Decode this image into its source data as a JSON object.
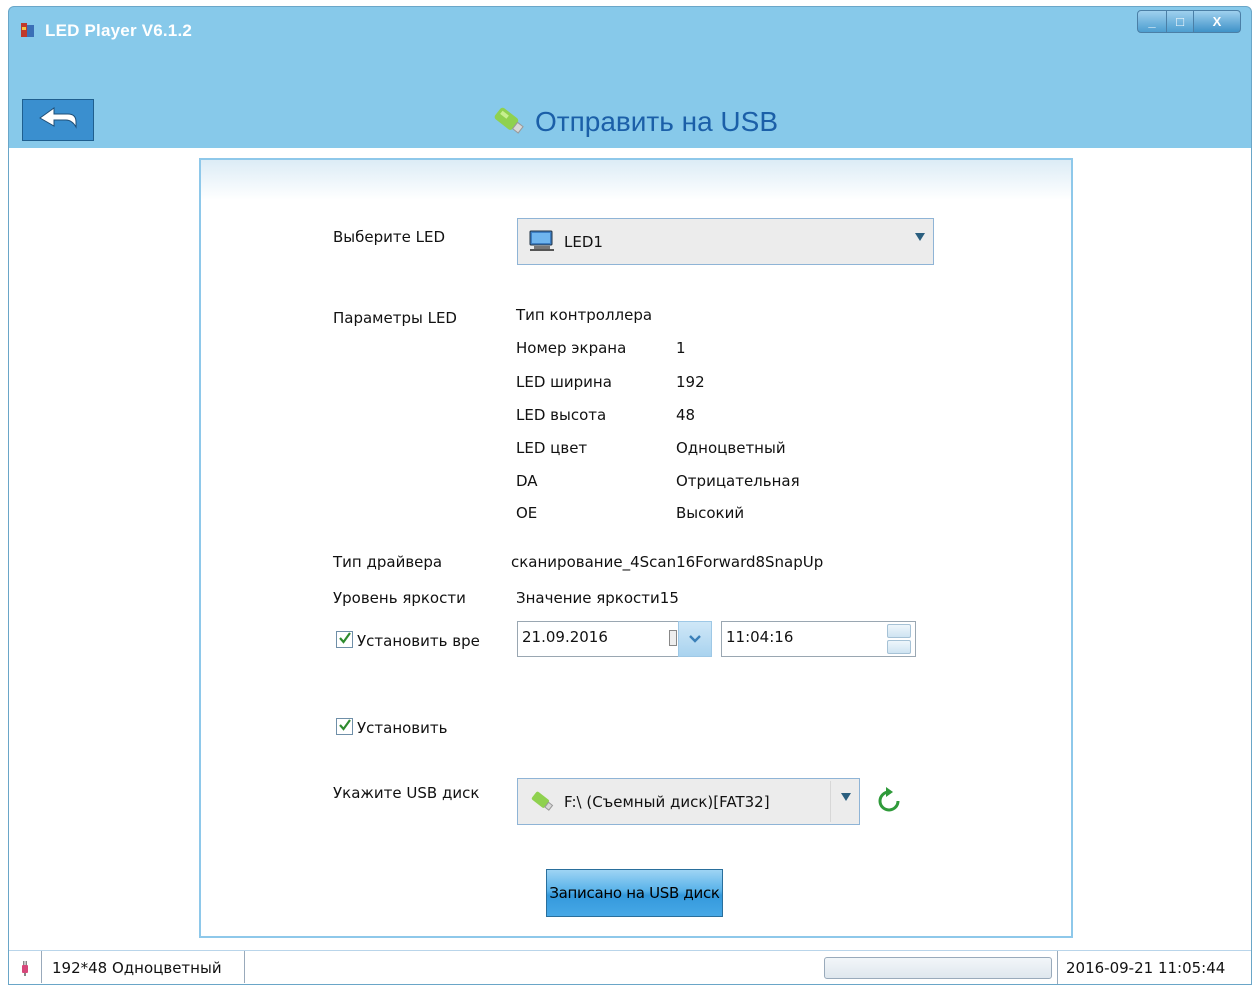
{
  "window": {
    "title": "LED Player V6.1.2",
    "controls": {
      "minimize": "_",
      "maximize": "□",
      "close": "X"
    }
  },
  "header": {
    "title": "Отправить на USB"
  },
  "form": {
    "select_led_label": "Выберите LED",
    "led_selected": "LED1",
    "led_params_label": "Параметры LED",
    "params": [
      {
        "name": "Тип контроллера",
        "value": ""
      },
      {
        "name": "Номер экрана",
        "value": "1"
      },
      {
        "name": "LED ширина",
        "value": "192"
      },
      {
        "name": "LED высота",
        "value": "48"
      },
      {
        "name": "LED цвет",
        "value": "Одноцветный"
      },
      {
        "name": "DA",
        "value": "Отрицательная"
      },
      {
        "name": "OE",
        "value": "Высокий"
      }
    ],
    "driver_type_label": "Тип драйвера",
    "driver_type_value": "сканирование_4Scan16Forward8SnapUp",
    "brightness_label": "Уровень яркости",
    "brightness_value": "Значение яркости15",
    "set_time_label": "Установить вре",
    "set_time_checked": true,
    "date_value": "21.09.2016",
    "time_value": "11:04:16",
    "set_label": "Установить",
    "set_checked": true,
    "usb_label": "Укажите USB диск",
    "usb_selected": "F:\\ (Съемный диск)[FAT32]",
    "write_button": "Записано на USB диск"
  },
  "statusbar": {
    "screen_info": "192*48 Одноцветный",
    "datetime": "2016-09-21 11:05:44"
  },
  "icons": {
    "app": "led-player-icon",
    "back": "back-arrow-icon",
    "usb": "usb-stick-icon",
    "monitor": "monitor-icon",
    "calendar": "calendar-icon",
    "refresh": "refresh-icon",
    "plug": "plug-icon"
  },
  "colors": {
    "window_bg": "#87c9ea",
    "title_text": "#1b5fa8",
    "button": "#3499dc"
  }
}
